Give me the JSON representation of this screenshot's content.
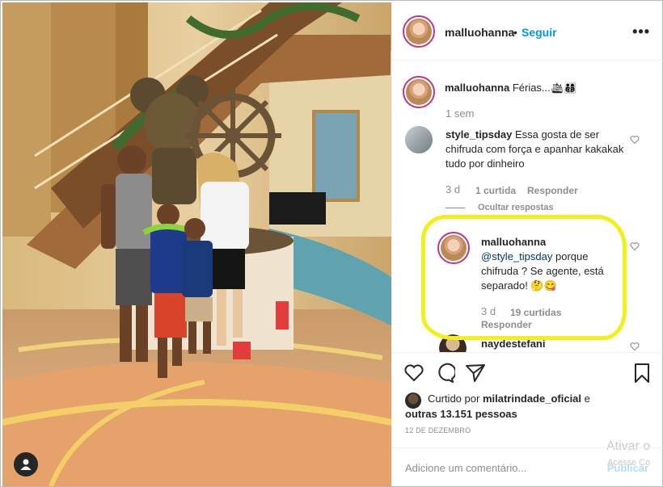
{
  "post": {
    "username": "malluohanna",
    "separator": "•",
    "follow_label": "Seguir",
    "more_icon": "more-horizontal-icon"
  },
  "caption": {
    "username": "malluohanna",
    "text": "Férias...🛳👨‍👩‍👦‍👦",
    "time": "1 sem"
  },
  "comment1": {
    "username": "style_tipsday",
    "text": "Essa gosta de ser chifruda com força e apanhar kakakak tudo por dinheiro",
    "time": "3 d",
    "likes": "1 curtida",
    "reply": "Responder",
    "hide_replies": "Ocultar respostas"
  },
  "reply1": {
    "username": "malluohanna",
    "mention": "@style_tipsday",
    "text": "porque chifruda ? Se agente, está separado! 🤔😋",
    "time": "3 d",
    "likes": "19 curtidas",
    "reply": "Responder"
  },
  "comment2": {
    "username": "naydestefani"
  },
  "footer": {
    "liked_prefix": "Curtido por",
    "liked_user": "milatrindade_oficial",
    "liked_and": "e",
    "liked_others": "outras 13.151 pessoas",
    "date": "12 DE DEZEMBRO",
    "add_comment_placeholder": "Adicione um comentário...",
    "publish": "Publicar"
  },
  "watermark": {
    "line1": "Ativar o",
    "line2": "Acesse Co"
  },
  "colors": {
    "link_blue": "#0095f6",
    "highlight_yellow": "#f4ef1b",
    "muted_gray": "#8e8e8e"
  }
}
